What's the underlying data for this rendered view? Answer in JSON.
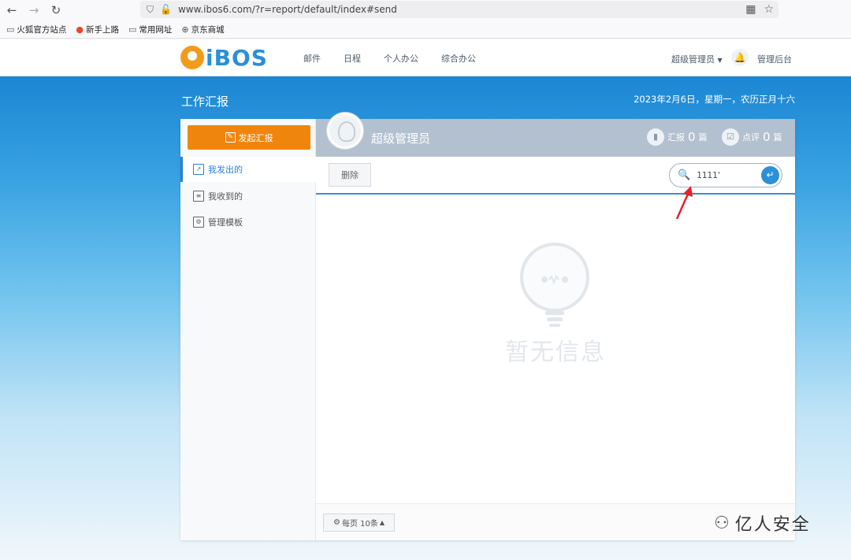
{
  "browser": {
    "back_icon": "arrow-left-icon",
    "forward_icon": "arrow-right-icon",
    "reload_icon": "reload-icon",
    "url": "www.ibos6.com/?r=report/default/index#send",
    "bookmarks": [
      {
        "label": "火狐官方站点",
        "icon": "folder-icon"
      },
      {
        "label": "新手上路",
        "icon": "firefox-icon"
      },
      {
        "label": "常用网址",
        "icon": "folder-icon"
      },
      {
        "label": "京东商城",
        "icon": "globe-icon"
      }
    ]
  },
  "header": {
    "logo_text": "iBOS",
    "nav": [
      "邮件",
      "日程",
      "个人办公",
      "综合办公"
    ],
    "user_menu": "超级管理员",
    "admin_link": "管理后台"
  },
  "page": {
    "title": "工作汇报",
    "date": "2023年2月6日，星期一，农历正月十六"
  },
  "sidebar": {
    "compose_label": "发起汇报",
    "items": [
      {
        "label": "我发出的",
        "active": true
      },
      {
        "label": "我收到的",
        "active": false
      },
      {
        "label": "管理模板",
        "active": false
      }
    ]
  },
  "profile": {
    "name": "超级管理员",
    "report_label": "汇报",
    "report_count": "0",
    "report_unit": "篇",
    "review_label": "点评",
    "review_count": "0",
    "review_unit": "篇"
  },
  "toolbar": {
    "delete_label": "删除",
    "search_value": "1111'"
  },
  "empty_state": {
    "text": "暂无信息"
  },
  "footer": {
    "per_page": "每页 10条"
  },
  "watermark": {
    "text": "亿人安全"
  },
  "colors": {
    "accent": "#2b8fd9",
    "compose": "#f0850d",
    "annotation": "#e8202a"
  }
}
